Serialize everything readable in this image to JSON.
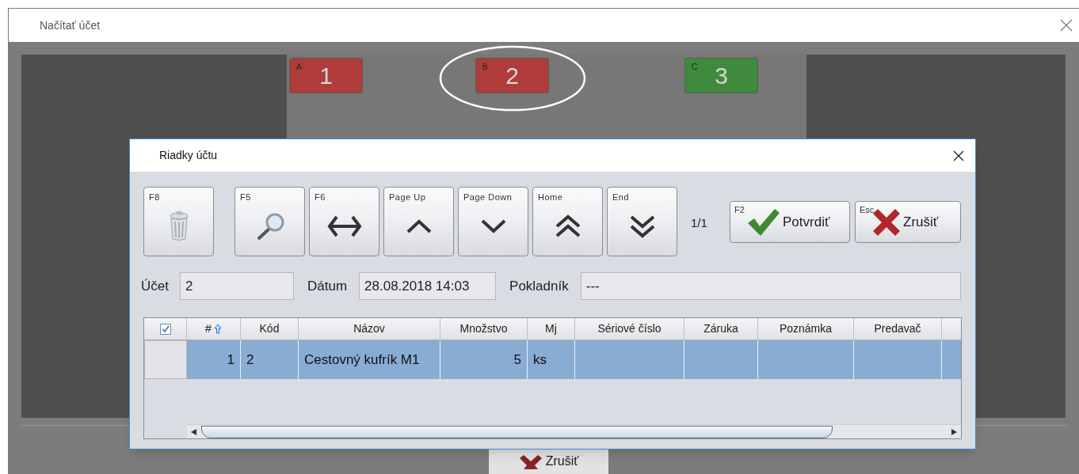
{
  "window": {
    "title": "Načítať účet"
  },
  "tables": [
    {
      "letter": "A",
      "label": "1",
      "color": "#b03b3b"
    },
    {
      "letter": "B",
      "label": "2",
      "color": "#b03b3b",
      "highlighted": true
    },
    {
      "letter": "C",
      "label": "3",
      "color": "#3f8a3c"
    }
  ],
  "background_button": {
    "label": "Zrušiť"
  },
  "dialog": {
    "title": "Riadky účtu",
    "toolbar": [
      {
        "key": "F8",
        "kind": "delete"
      },
      {
        "key": "F5",
        "kind": "search"
      },
      {
        "key": "F6",
        "kind": "swap"
      },
      {
        "key": "Page Up",
        "kind": "up"
      },
      {
        "key": "Page Down",
        "kind": "down"
      },
      {
        "key": "Home",
        "kind": "first"
      },
      {
        "key": "End",
        "kind": "last"
      }
    ],
    "page_indicator": "1/1",
    "actions": [
      {
        "key": "F2",
        "label": "Potvrdiť",
        "kind": "confirm"
      },
      {
        "key": "Esc",
        "label": "Zrušiť",
        "kind": "cancel"
      }
    ],
    "fields": [
      {
        "label": "Účet",
        "value": "2"
      },
      {
        "label": "Dátum",
        "value": "28.08.2018 14:03"
      },
      {
        "label": "Pokladník",
        "value": "---"
      }
    ],
    "table": {
      "select_all_checked": true,
      "columns": [
        {
          "label": "#",
          "sorted": true,
          "kind": "number"
        },
        {
          "label": "Kód",
          "sorted": false,
          "kind": "text"
        },
        {
          "label": "Názov",
          "sorted": false,
          "kind": "text"
        },
        {
          "label": "Množstvo",
          "sorted": false,
          "kind": "number"
        },
        {
          "label": "Mj",
          "sorted": false,
          "kind": "text"
        },
        {
          "label": "Sériové číslo",
          "sorted": false,
          "kind": "text"
        },
        {
          "label": "Záruka",
          "sorted": false,
          "kind": "text"
        },
        {
          "label": "Poznámka",
          "sorted": false,
          "kind": "text"
        },
        {
          "label": "Predavač",
          "sorted": false,
          "kind": "text"
        }
      ],
      "rows": [
        {
          "selected": true,
          "cells": [
            "1",
            "2",
            "Cestovný kufrík M1",
            "5",
            "ks"
          ]
        }
      ]
    }
  }
}
